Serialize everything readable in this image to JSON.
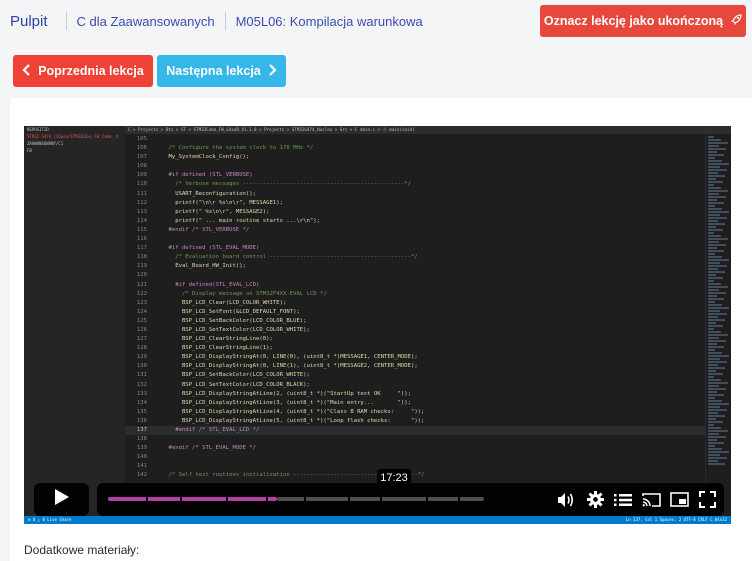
{
  "breadcrumb": {
    "brand": "Pulpit",
    "course": "C dla Zaawansowanych",
    "lesson": "M05L06: Kompilacja warunkowa"
  },
  "buttons": {
    "complete": "Oznacz lekcję jako ukończoną",
    "prev": "Poprzednia lekcja",
    "next": "Następna lekcja"
  },
  "editor": {
    "path": "C > Projects > Bts > ST > STM32Cube_FW_G4xxB_V1.3.0 > Projects > STM32G474_Nucleo > Src > C main.c > ⓕ main(void)",
    "explorer": [
      "REPOSITIO",
      "STM32 G474 (IOpen/STM32G4xx FW Comm. ©",
      "ZAAWANSOWANY/C1",
      "FB"
    ],
    "lines": [
      {
        "n": "105",
        "t": ""
      },
      {
        "n": "106",
        "t": "    /* Configure the system clock to 170 MHz */"
      },
      {
        "n": "107",
        "t": "    My_SystemClock_Config();"
      },
      {
        "n": "108",
        "t": ""
      },
      {
        "n": "109",
        "t": "    #if defined (STL_VERBOSE)"
      },
      {
        "n": "110",
        "t": "      /* Verbose messages ------------------------------------------------*/"
      },
      {
        "n": "111",
        "t": "      USART_Reconfiguration();"
      },
      {
        "n": "112",
        "t": "      printf(\"\\n\\r %s\\n\\r\", MESSAGE1);"
      },
      {
        "n": "113",
        "t": "      printf(\" %s\\n\\r\", MESSAGE2);"
      },
      {
        "n": "114",
        "t": "      printf(\" ... main routine starts ...\\r\\n\");"
      },
      {
        "n": "115",
        "t": "    #endif /* STL_VERBOSE */"
      },
      {
        "n": "116",
        "t": ""
      },
      {
        "n": "117",
        "t": "    #if defined (STL_EVAL_MODE)"
      },
      {
        "n": "118",
        "t": "      /* Evaluation board control ------------------------------------------*/"
      },
      {
        "n": "119",
        "t": "      Eval_Board_HW_Init();"
      },
      {
        "n": "120",
        "t": ""
      },
      {
        "n": "121",
        "t": "      #if defined(STL_EVAL_LCD)"
      },
      {
        "n": "122",
        "t": "        /* Display message on STM32F4XX-EVAL LCD */"
      },
      {
        "n": "123",
        "t": "        BSP_LCD_Clear(LCD_COLOR_WHITE);"
      },
      {
        "n": "124",
        "t": "        BSP_LCD_SetFont(&LCD_DEFAULT_FONT);"
      },
      {
        "n": "125",
        "t": "        BSP_LCD_SetBackColor(LCD_COLOR_BLUE);"
      },
      {
        "n": "126",
        "t": "        BSP_LCD_SetTextColor(LCD_COLOR_WHITE);"
      },
      {
        "n": "127",
        "t": "        BSP_LCD_ClearStringLine(0);"
      },
      {
        "n": "128",
        "t": "        BSP_LCD_ClearStringLine(1);"
      },
      {
        "n": "129",
        "t": "        BSP_LCD_DisplayStringAt(0, LINE(0), (uint8_t *)MESSAGE1, CENTER_MODE);"
      },
      {
        "n": "130",
        "t": "        BSP_LCD_DisplayStringAt(0, LINE(1), (uint8_t *)MESSAGE2, CENTER_MODE);"
      },
      {
        "n": "131",
        "t": "        BSP_LCD_SetBackColor(LCD_COLOR_WHITE);"
      },
      {
        "n": "132",
        "t": "        BSP_LCD_SetTextColor(LCD_COLOR_BLACK);"
      },
      {
        "n": "133",
        "t": "        BSP_LCD_DisplayStringAtLine(2, (uint8_t *)(\"StartUp test OK     \"));"
      },
      {
        "n": "134",
        "t": "        BSP_LCD_DisplayStringAtLine(3, (uint8_t *)(\"Main entry...       \"));"
      },
      {
        "n": "135",
        "t": "        BSP_LCD_DisplayStringAtLine(4, (uint8_t *)(\"Class B RAM checks:     \"));"
      },
      {
        "n": "136",
        "t": "        BSP_LCD_DisplayStringAtLine(5, (uint8_t *)(\"Loop flash checks:      \"));"
      },
      {
        "n": "137",
        "t": "      #endif /* STL_EVAL_LCD */"
      },
      {
        "n": "138",
        "t": ""
      },
      {
        "n": "139",
        "t": "    #endif /* STL_EVAL_MODE */"
      },
      {
        "n": "140",
        "t": ""
      },
      {
        "n": "141",
        "t": ""
      },
      {
        "n": "142",
        "t": "    /* Self test routines initialization -------------------------------------*/"
      }
    ],
    "status_left": "⊗ 0 △ 0    Live Share",
    "status_right": "Ln 137, Col 1    Spaces: 2    UTF-8    CRLF    C    Win32"
  },
  "player": {
    "time_tooltip": "17:23",
    "progress": 0.45,
    "icons": [
      "play-icon",
      "volume-icon",
      "settings-icon",
      "chapters-icon",
      "cast-icon",
      "pip-icon",
      "fullscreen-icon"
    ]
  },
  "extra_label": "Dodatkowe materiały:",
  "colors": {
    "brand": "#2f3ea8",
    "danger": "#e8473b",
    "info": "#35b7ea",
    "progress": "#b43ea8"
  }
}
